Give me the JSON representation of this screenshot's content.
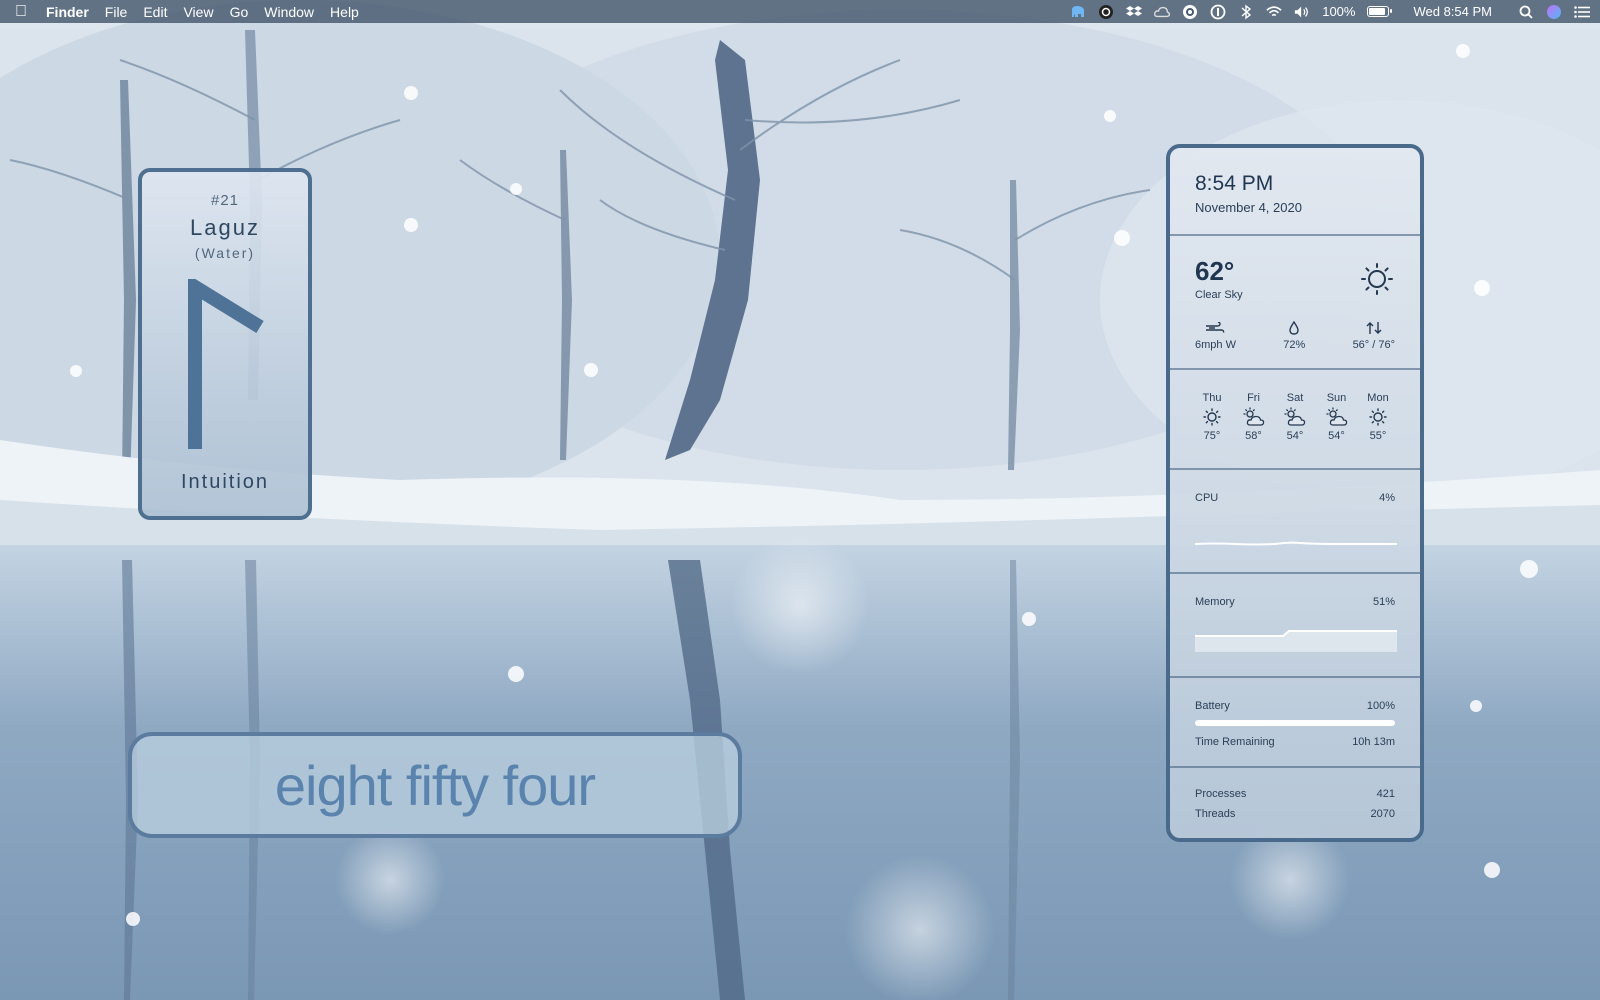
{
  "menubar": {
    "app": "Finder",
    "menus": [
      "File",
      "Edit",
      "View",
      "Go",
      "Window",
      "Help"
    ],
    "battery_percent": "100%",
    "battery_level": 1.0,
    "clock": "Wed 8:54 PM",
    "status_icons": [
      "elephant-icon",
      "camera-icon",
      "dropbox-icon",
      "cloud-icon",
      "creative-cloud-icon",
      "onepassword-icon",
      "bluetooth-icon",
      "wifi-icon",
      "volume-icon"
    ]
  },
  "rune": {
    "number": "#21",
    "name": "Laguz",
    "element": "(Water)",
    "meaning": "Intuition",
    "color": "#4f7397"
  },
  "wordclock": {
    "text": "eight fifty four",
    "color": "#5a83ad"
  },
  "panel": {
    "time": "8:54 PM",
    "date": "November 4, 2020",
    "weather": {
      "temp": "62°",
      "condition": "Clear Sky",
      "icon": "sun-icon",
      "wind": "6mph W",
      "humidity": "72%",
      "range": "56° / 76°"
    },
    "forecast": [
      {
        "day": "Thu",
        "temp": "75°",
        "icon": "sun-icon"
      },
      {
        "day": "Fri",
        "temp": "58°",
        "icon": "partly-cloudy-icon"
      },
      {
        "day": "Sat",
        "temp": "54°",
        "icon": "partly-cloudy-icon"
      },
      {
        "day": "Sun",
        "temp": "54°",
        "icon": "partly-cloudy-icon"
      },
      {
        "day": "Mon",
        "temp": "55°",
        "icon": "sun-icon"
      }
    ],
    "cpu": {
      "label": "CPU",
      "value": "4%"
    },
    "memory": {
      "label": "Memory",
      "value": "51%"
    },
    "battery": {
      "label": "Battery",
      "value": "100%",
      "level": 1.0,
      "remaining_label": "Time Remaining",
      "remaining": "10h 13m"
    },
    "processes": {
      "label": "Processes",
      "value": "421"
    },
    "threads": {
      "label": "Threads",
      "value": "2070"
    }
  }
}
